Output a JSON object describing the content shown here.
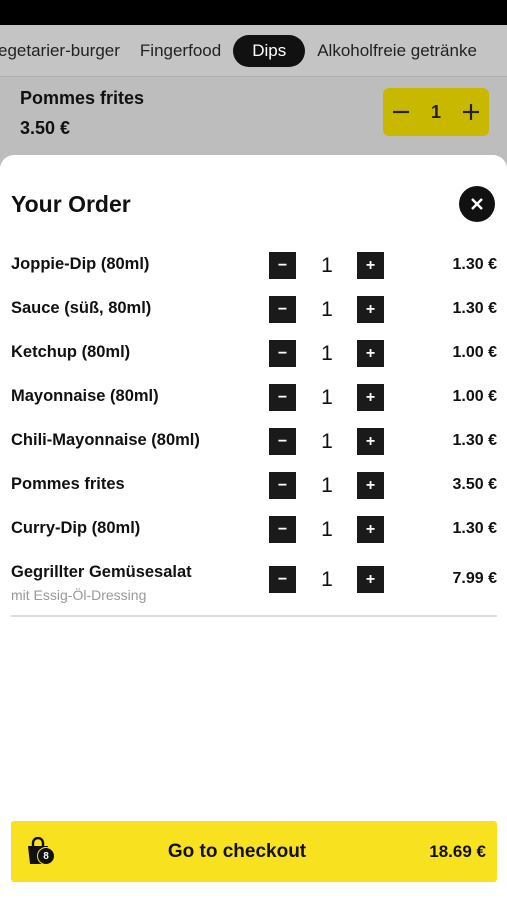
{
  "categories": [
    {
      "label": "egetarier-burger",
      "active": false
    },
    {
      "label": "Fingerfood",
      "active": false
    },
    {
      "label": "Dips",
      "active": true
    },
    {
      "label": "Alkoholfreie getränke",
      "active": false
    }
  ],
  "background_item": {
    "name": "Pommes frites",
    "price": "3.50 €",
    "quantity": "1"
  },
  "order": {
    "title": "Your Order",
    "items": [
      {
        "name": "Joppie-Dip (80ml)",
        "quantity": "1",
        "price": "1.30 €"
      },
      {
        "name": "Sauce (süß, 80ml)",
        "quantity": "1",
        "price": "1.30 €"
      },
      {
        "name": "Ketchup (80ml)",
        "quantity": "1",
        "price": "1.00 €"
      },
      {
        "name": "Mayonnaise (80ml)",
        "quantity": "1",
        "price": "1.00 €"
      },
      {
        "name": "Chili-Mayonnaise (80ml)",
        "quantity": "1",
        "price": "1.30 €"
      },
      {
        "name": "Pommes frites",
        "quantity": "1",
        "price": "3.50 €"
      },
      {
        "name": "Curry-Dip (80ml)",
        "quantity": "1",
        "price": "1.30 €"
      },
      {
        "name": "Gegrillter Gemüsesalat",
        "subtitle": "mit Essig-Öl-Dressing",
        "quantity": "1",
        "price": "7.99 €"
      }
    ]
  },
  "checkout": {
    "label": "Go to checkout",
    "total": "18.69 €",
    "cart_count": "8"
  },
  "colors": {
    "accent": "#f8e21f",
    "dark": "#111111"
  }
}
